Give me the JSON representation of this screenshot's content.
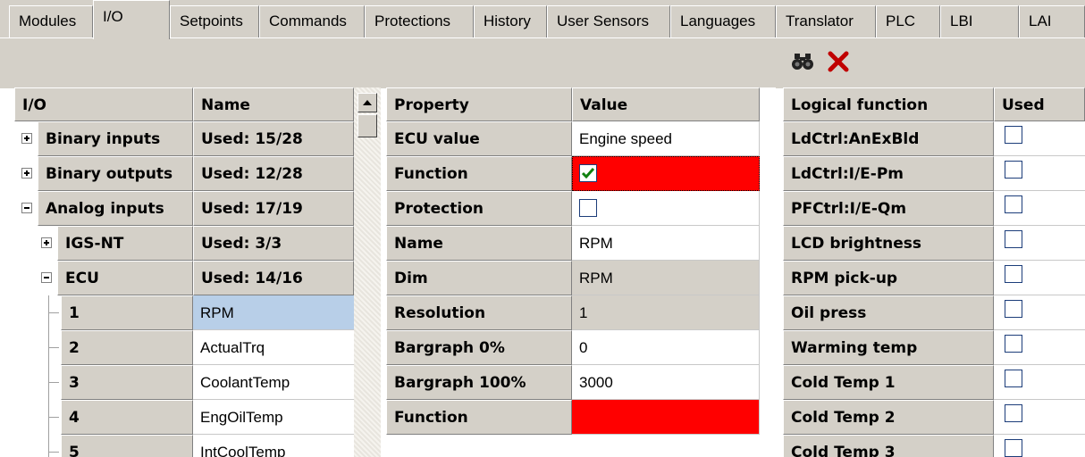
{
  "tabs": [
    "Modules",
    "I/O",
    "Setpoints",
    "Commands",
    "Protections",
    "History",
    "User Sensors",
    "Languages",
    "Translator",
    "PLC",
    "LBI",
    "LAI"
  ],
  "toolbar": {
    "find_icon": "binoculars-icon",
    "delete_icon": "red-x-icon"
  },
  "io_panel": {
    "headers": {
      "io": "I/O",
      "name": "Name"
    },
    "rows": [
      {
        "io": "Binary inputs",
        "name": "Used: 15/28"
      },
      {
        "io": "Binary outputs",
        "name": "Used: 12/28"
      },
      {
        "io": "Analog inputs",
        "name": "Used: 17/19"
      },
      {
        "io": "IGS-NT",
        "name": "Used: 3/3"
      },
      {
        "io": "ECU",
        "name": "Used: 14/16"
      },
      {
        "io": "1",
        "name": "RPM"
      },
      {
        "io": "2",
        "name": "ActualTrq"
      },
      {
        "io": "3",
        "name": "CoolantTemp"
      },
      {
        "io": "4",
        "name": "EngOilTemp"
      },
      {
        "io": "5",
        "name": "IntCoolTemp"
      }
    ]
  },
  "property_panel": {
    "headers": {
      "property": "Property",
      "value": "Value"
    },
    "rows": [
      {
        "property": "ECU value",
        "value": "Engine speed"
      },
      {
        "property": "Function",
        "value": ""
      },
      {
        "property": "Protection",
        "value": ""
      },
      {
        "property": "Name",
        "value": "RPM"
      },
      {
        "property": "Dim",
        "value": "RPM"
      },
      {
        "property": "Resolution",
        "value": "1"
      },
      {
        "property": "Bargraph 0%",
        "value": "0"
      },
      {
        "property": "Bargraph 100%",
        "value": "3000"
      },
      {
        "property": "Function",
        "value": ""
      }
    ]
  },
  "logical_panel": {
    "headers": {
      "function": "Logical function",
      "used": "Used"
    },
    "rows": [
      {
        "function": "LdCtrl:AnExBld"
      },
      {
        "function": "LdCtrl:I/E-Pm"
      },
      {
        "function": "PFCtrl:I/E-Qm"
      },
      {
        "function": "LCD brightness"
      },
      {
        "function": "RPM pick-up"
      },
      {
        "function": "Oil press"
      },
      {
        "function": "Warming temp"
      },
      {
        "function": "Cold Temp 1"
      },
      {
        "function": "Cold Temp 2"
      },
      {
        "function": "Cold Temp 3"
      }
    ]
  },
  "colors": {
    "selected_row": "#b8cfe8",
    "function_red": "#ff0000",
    "readonly_gray": "#d4d0c8"
  }
}
